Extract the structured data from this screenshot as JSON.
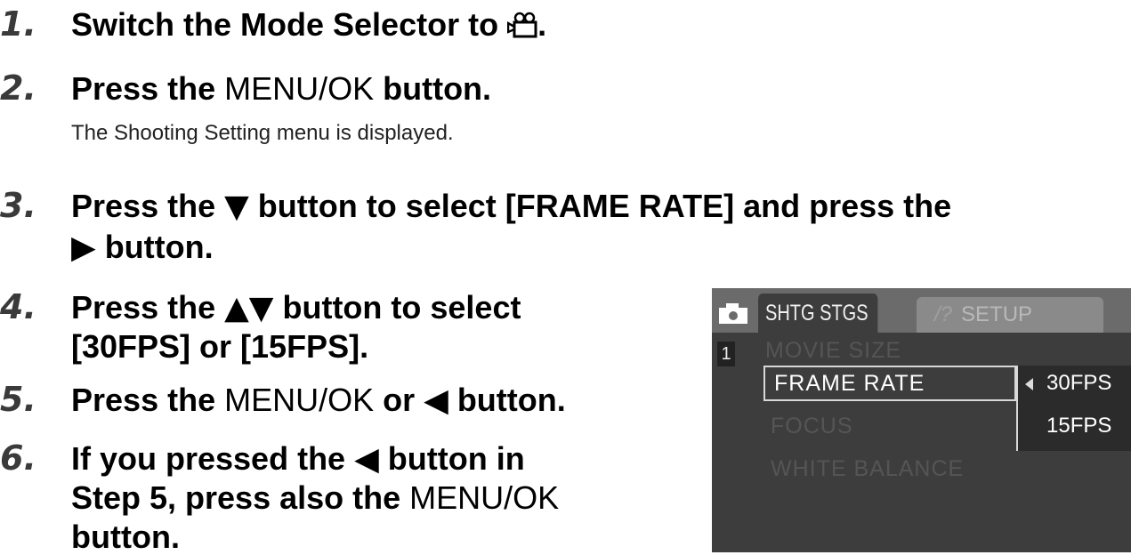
{
  "steps": [
    {
      "number": "1.",
      "before": "Switch the Mode Selector to ",
      "icon": "movie-mode-icon",
      "after": "."
    },
    {
      "number": "2.",
      "before": "Press the ",
      "menuok": "MENU/OK",
      "after": " button.",
      "sub": "The Shooting Setting menu is displayed."
    },
    {
      "number": "3.",
      "before": "Press the ",
      "down_glyph": "▼",
      "middle": " button to select [FRAME RATE] and press the",
      "right_glyph": "▶",
      "after": " button."
    },
    {
      "number": "4.",
      "before": "Press the ",
      "updown_glyph": "▲▼",
      "after": " button to select",
      "line2": "[30FPS] or [15FPS]."
    },
    {
      "number": "5.",
      "before": "Press the ",
      "menuok": "MENU/OK",
      "middle": " or ",
      "left_glyph": "◀",
      "after": " button."
    },
    {
      "number": "6.",
      "before": "If you pressed the ",
      "left_glyph": "◀",
      "after": " button in",
      "line2": "Step 5, press also the ",
      "menuok": "MENU/OK",
      "line3": "button."
    }
  ],
  "lcd": {
    "tab_active": "SHTG STGS",
    "tab_inactive": "SETUP",
    "page": "1",
    "items": [
      "MOVIE SIZE",
      "FRAME RATE",
      "FOCUS",
      "WHITE BALANCE"
    ],
    "options": [
      "30FPS",
      "15FPS"
    ],
    "colors": {
      "screen_bg": "#3d3d3d",
      "tab_bar": "#6b6b6b",
      "highlight": "#ffffff",
      "dim": "#555555"
    }
  }
}
